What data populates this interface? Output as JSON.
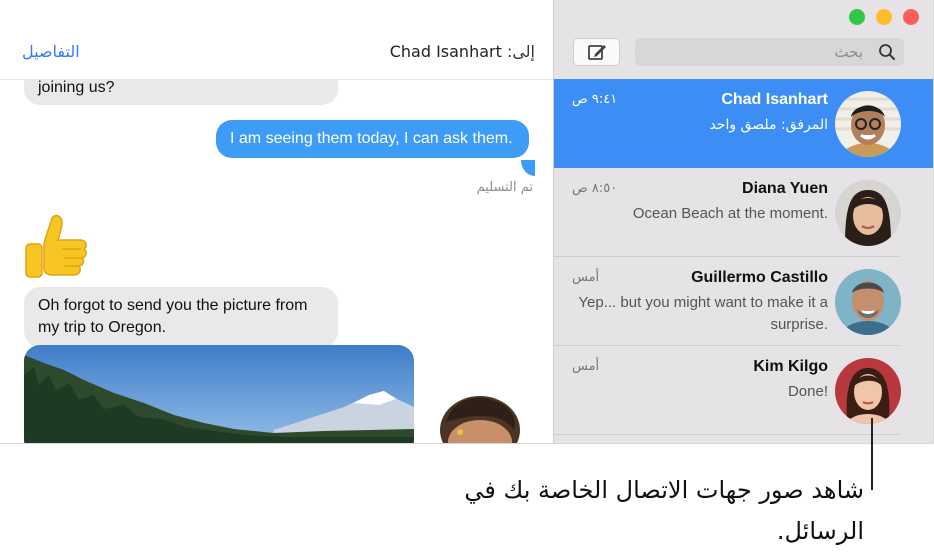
{
  "chat": {
    "details_label": "التفاصيل",
    "to_label": "إلى:",
    "to_name": "Chad Isanhart",
    "messages": [
      "joining us?",
      "I am seeing them today, I can ask them.",
      "Oh forgot to send you the picture from my trip to Oregon."
    ],
    "delivered": "تم التسليم"
  },
  "sidebar": {
    "search_placeholder": "بحث",
    "conversations": [
      {
        "name": "Chad Isanhart",
        "preview": "المرفق: ملصق واحد",
        "time": "٩:٤١ ص",
        "selected": true
      },
      {
        "name": "Diana Yuen",
        "preview": "Ocean Beach at the moment.",
        "time": "٨:٥٠ ص"
      },
      {
        "name": "Guillermo Castillo",
        "preview": "Yep... but you might want to make it a surprise.",
        "time": "أمس"
      },
      {
        "name": "Kim Kilgo",
        "preview": "Done!",
        "time": "أمس"
      }
    ]
  },
  "callout": {
    "text": "شاهد صور جهات الاتصال الخاصة بك في الرسائل."
  },
  "colors": {
    "accent": "#3c8ef4",
    "bubble_out": "#3c9cf6",
    "bubble_in": "#e9e9eb",
    "sidebar_bg": "#e5e3e5"
  }
}
